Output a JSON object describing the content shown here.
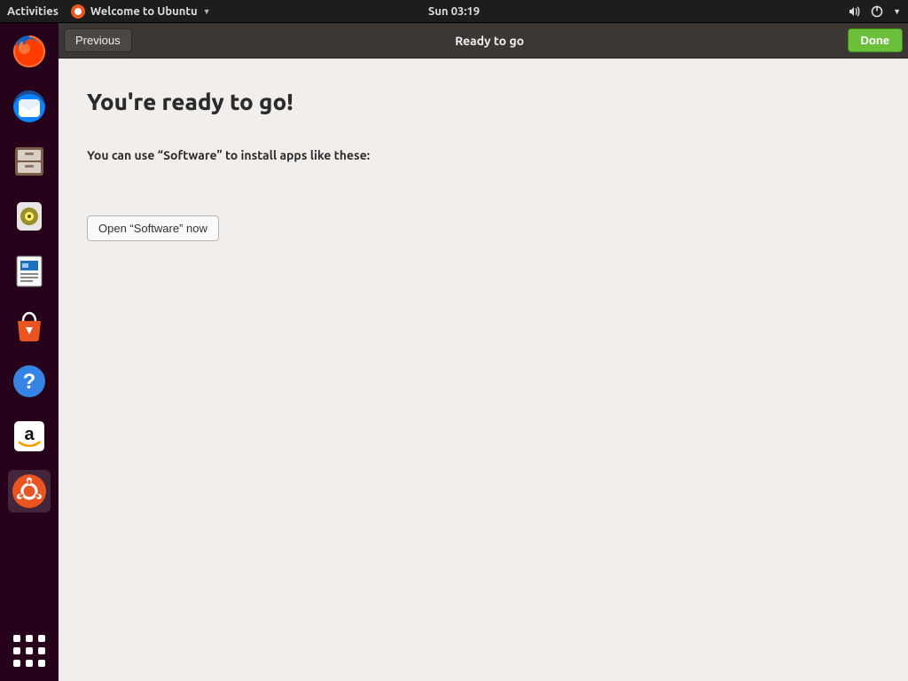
{
  "topbar": {
    "activities": "Activities",
    "app_menu_label": "Welcome to Ubuntu",
    "clock": "Sun 03:19"
  },
  "headerbar": {
    "previous": "Previous",
    "title": "Ready to go",
    "done": "Done"
  },
  "page": {
    "heading": "You're ready to go!",
    "subheading": "You can use “Software” to install apps like these:",
    "open_software": "Open “Software” now"
  },
  "dock": {
    "items": [
      {
        "name": "firefox"
      },
      {
        "name": "thunderbird"
      },
      {
        "name": "files"
      },
      {
        "name": "rhythmbox"
      },
      {
        "name": "writer"
      },
      {
        "name": "software"
      },
      {
        "name": "help"
      },
      {
        "name": "amazon"
      },
      {
        "name": "welcome",
        "active": true
      }
    ]
  },
  "colors": {
    "ubuntu_orange": "#e95420",
    "ubuntu_dark": "#2c001e",
    "headerbar_bg": "#3b3735",
    "done_green": "#6bbf3b",
    "content_bg": "#f1eeec"
  }
}
